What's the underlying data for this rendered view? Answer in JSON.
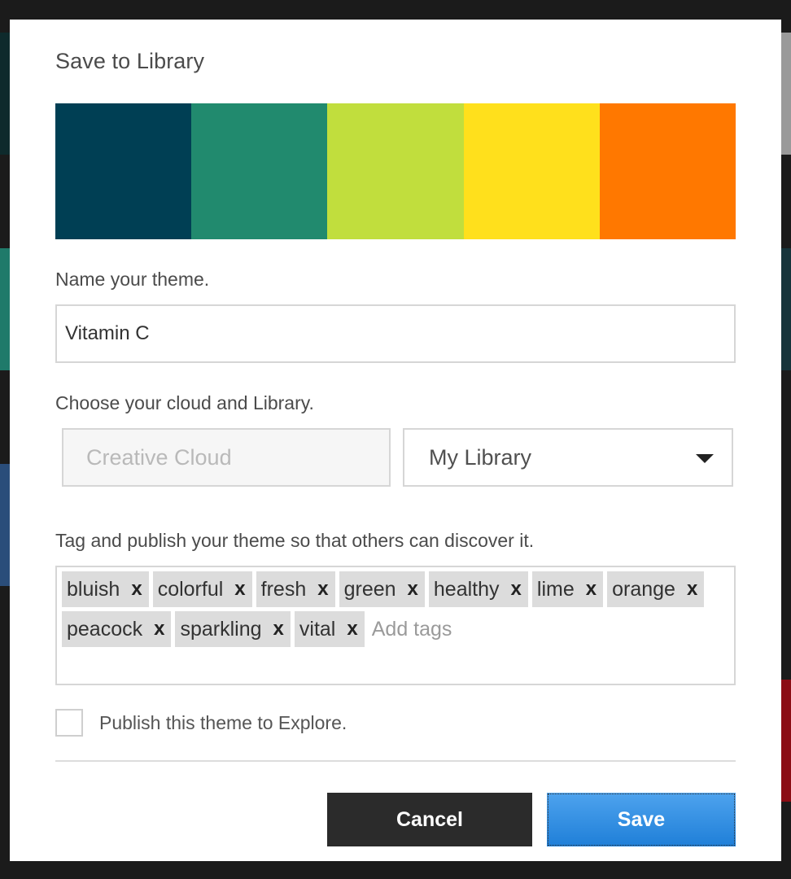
{
  "dialog": {
    "title": "Save to Library",
    "swatches": [
      "#003F54",
      "#218A6E",
      "#C1DE3D",
      "#FFE01C",
      "#FF7800"
    ],
    "name_label": "Name your theme.",
    "name_value": "Vitamin C",
    "cloud_label": "Choose your cloud and Library.",
    "cloud_placeholder": "Creative Cloud",
    "library_selected": "My Library",
    "tags_label": "Tag and publish your theme so that others can discover it.",
    "tags": [
      {
        "label": "bluish",
        "remove": "x"
      },
      {
        "label": "colorful",
        "remove": "x"
      },
      {
        "label": "fresh",
        "remove": "x"
      },
      {
        "label": "green",
        "remove": "x"
      },
      {
        "label": "healthy",
        "remove": "x"
      },
      {
        "label": "lime",
        "remove": "x"
      },
      {
        "label": "orange",
        "remove": "x"
      },
      {
        "label": "peacock",
        "remove": "x"
      },
      {
        "label": "sparkling",
        "remove": "x"
      },
      {
        "label": "vital",
        "remove": "x"
      }
    ],
    "tags_placeholder": "Add tags",
    "publish_label": "Publish this theme to Explore.",
    "publish_checked": false,
    "cancel_label": "Cancel",
    "save_label": "Save"
  }
}
